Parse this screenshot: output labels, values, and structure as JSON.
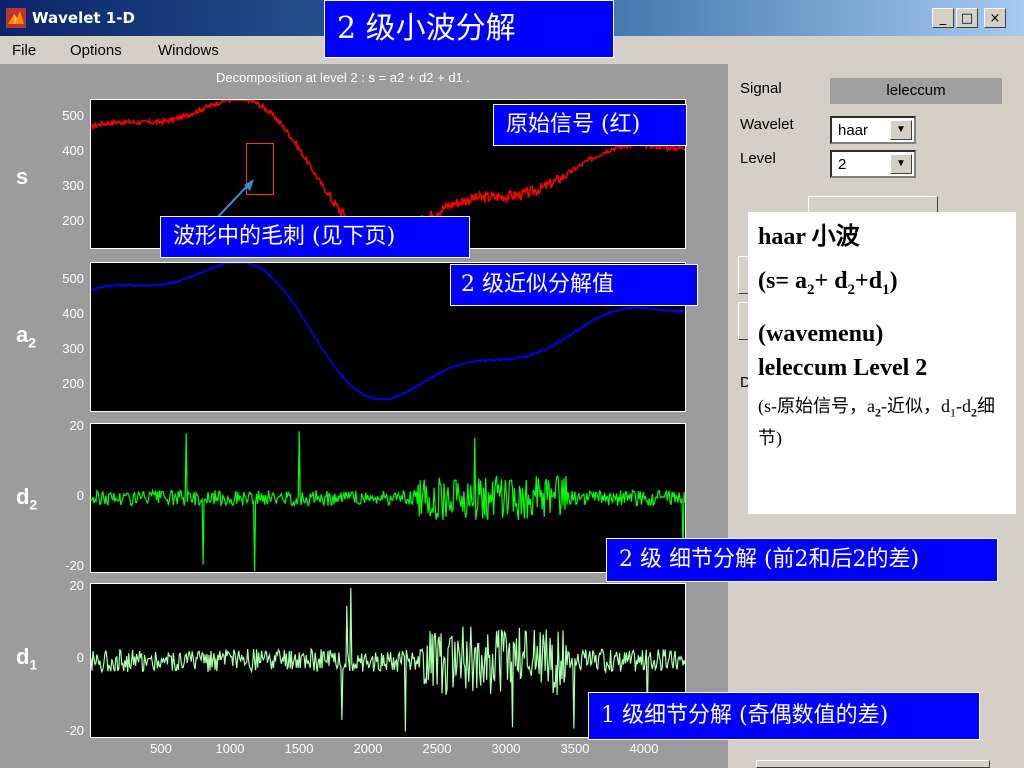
{
  "window": {
    "title": "Wavelet 1-D",
    "buttons": [
      "_",
      "□",
      "×"
    ]
  },
  "menu": [
    "File",
    "Options",
    "Windows"
  ],
  "figure": {
    "title": "Decomposition at level 2 : s = a2 + d2 + d1 .",
    "axes": [
      {
        "label": "s",
        "sub": "",
        "ticks": [
          "500",
          "400",
          "300",
          "200"
        ],
        "color": "#ff0000"
      },
      {
        "label": "a",
        "sub": "2",
        "ticks": [
          "500",
          "400",
          "300",
          "200"
        ],
        "color": "#0000ff"
      },
      {
        "label": "d",
        "sub": "2",
        "ticks": [
          "20",
          "0",
          "-20"
        ],
        "color": "#00ff00"
      },
      {
        "label": "d",
        "sub": "1",
        "ticks": [
          "20",
          "0",
          "-20"
        ],
        "color": "#aaffaa"
      }
    ],
    "xticks": [
      "500",
      "1000",
      "1500",
      "2000",
      "2500",
      "3000",
      "3500",
      "4000"
    ]
  },
  "chart_data": [
    {
      "type": "line",
      "name": "s",
      "ylim": [
        150,
        550
      ],
      "color": "#ff0000"
    },
    {
      "type": "line",
      "name": "a2",
      "ylim": [
        150,
        550
      ],
      "color": "#0000ff"
    },
    {
      "type": "line",
      "name": "d2",
      "ylim": [
        -20,
        20
      ],
      "color": "#00ff00"
    },
    {
      "type": "line",
      "name": "d1",
      "ylim": [
        -20,
        20
      ],
      "color": "#aaffaa"
    }
  ],
  "panel": {
    "signal_label": "Signal",
    "signal_value": "leleccum",
    "wavelet_label": "Wavelet",
    "wavelet_value": "haar",
    "level_label": "Level",
    "level_value": "2",
    "d_label": "D"
  },
  "callouts": {
    "main_title": "2 级小波分解",
    "original": "原始信号 (红)",
    "spike": "波形中的毛刺 (见下页)",
    "approx": "2 级近似分解值",
    "detail2": "2 级 细节分解 (前2和后2的差)",
    "detail1": "1 级细节分解 (奇偶数值的差)"
  },
  "note": {
    "line1": "haar 小波",
    "line2_a": "(s= a",
    "line2_b": "2",
    "line2_c": "+ d",
    "line2_d": "2",
    "line2_e": "+d",
    "line2_f": "1",
    "line2_g": ")",
    "line3": "(wavemenu)",
    "line4": "leleccum Level 2",
    "small_a": "(s-原始信号，a",
    "small_b": "2",
    "small_c": "-近似，d",
    "small_d": "1",
    "small_e": "-d",
    "small_f": "2",
    "small_g": "细节)"
  }
}
